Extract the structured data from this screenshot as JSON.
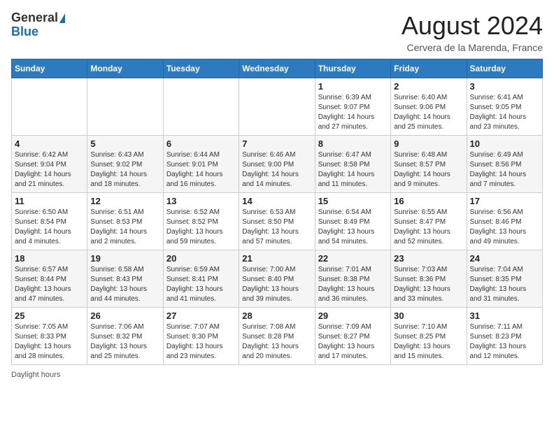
{
  "header": {
    "logo_general": "General",
    "logo_blue": "Blue",
    "month_title": "August 2024",
    "location": "Cervera de la Marenda, France"
  },
  "weekdays": [
    "Sunday",
    "Monday",
    "Tuesday",
    "Wednesday",
    "Thursday",
    "Friday",
    "Saturday"
  ],
  "footer": {
    "daylight_label": "Daylight hours"
  },
  "weeks": [
    {
      "days": [
        null,
        null,
        null,
        null,
        {
          "date": "1",
          "sunrise": "6:39 AM",
          "sunset": "9:07 PM",
          "daylight": "14 hours and 27 minutes."
        },
        {
          "date": "2",
          "sunrise": "6:40 AM",
          "sunset": "9:06 PM",
          "daylight": "14 hours and 25 minutes."
        },
        {
          "date": "3",
          "sunrise": "6:41 AM",
          "sunset": "9:05 PM",
          "daylight": "14 hours and 23 minutes."
        }
      ]
    },
    {
      "days": [
        {
          "date": "4",
          "sunrise": "6:42 AM",
          "sunset": "9:04 PM",
          "daylight": "14 hours and 21 minutes."
        },
        {
          "date": "5",
          "sunrise": "6:43 AM",
          "sunset": "9:02 PM",
          "daylight": "14 hours and 18 minutes."
        },
        {
          "date": "6",
          "sunrise": "6:44 AM",
          "sunset": "9:01 PM",
          "daylight": "14 hours and 16 minutes."
        },
        {
          "date": "7",
          "sunrise": "6:46 AM",
          "sunset": "9:00 PM",
          "daylight": "14 hours and 14 minutes."
        },
        {
          "date": "8",
          "sunrise": "6:47 AM",
          "sunset": "8:58 PM",
          "daylight": "14 hours and 11 minutes."
        },
        {
          "date": "9",
          "sunrise": "6:48 AM",
          "sunset": "8:57 PM",
          "daylight": "14 hours and 9 minutes."
        },
        {
          "date": "10",
          "sunrise": "6:49 AM",
          "sunset": "8:56 PM",
          "daylight": "14 hours and 7 minutes."
        }
      ]
    },
    {
      "days": [
        {
          "date": "11",
          "sunrise": "6:50 AM",
          "sunset": "8:54 PM",
          "daylight": "14 hours and 4 minutes."
        },
        {
          "date": "12",
          "sunrise": "6:51 AM",
          "sunset": "8:53 PM",
          "daylight": "14 hours and 2 minutes."
        },
        {
          "date": "13",
          "sunrise": "6:52 AM",
          "sunset": "8:52 PM",
          "daylight": "13 hours and 59 minutes."
        },
        {
          "date": "14",
          "sunrise": "6:53 AM",
          "sunset": "8:50 PM",
          "daylight": "13 hours and 57 minutes."
        },
        {
          "date": "15",
          "sunrise": "6:54 AM",
          "sunset": "8:49 PM",
          "daylight": "13 hours and 54 minutes."
        },
        {
          "date": "16",
          "sunrise": "6:55 AM",
          "sunset": "8:47 PM",
          "daylight": "13 hours and 52 minutes."
        },
        {
          "date": "17",
          "sunrise": "6:56 AM",
          "sunset": "8:46 PM",
          "daylight": "13 hours and 49 minutes."
        }
      ]
    },
    {
      "days": [
        {
          "date": "18",
          "sunrise": "6:57 AM",
          "sunset": "8:44 PM",
          "daylight": "13 hours and 47 minutes."
        },
        {
          "date": "19",
          "sunrise": "6:58 AM",
          "sunset": "8:43 PM",
          "daylight": "13 hours and 44 minutes."
        },
        {
          "date": "20",
          "sunrise": "6:59 AM",
          "sunset": "8:41 PM",
          "daylight": "13 hours and 41 minutes."
        },
        {
          "date": "21",
          "sunrise": "7:00 AM",
          "sunset": "8:40 PM",
          "daylight": "13 hours and 39 minutes."
        },
        {
          "date": "22",
          "sunrise": "7:01 AM",
          "sunset": "8:38 PM",
          "daylight": "13 hours and 36 minutes."
        },
        {
          "date": "23",
          "sunrise": "7:03 AM",
          "sunset": "8:36 PM",
          "daylight": "13 hours and 33 minutes."
        },
        {
          "date": "24",
          "sunrise": "7:04 AM",
          "sunset": "8:35 PM",
          "daylight": "13 hours and 31 minutes."
        }
      ]
    },
    {
      "days": [
        {
          "date": "25",
          "sunrise": "7:05 AM",
          "sunset": "8:33 PM",
          "daylight": "13 hours and 28 minutes."
        },
        {
          "date": "26",
          "sunrise": "7:06 AM",
          "sunset": "8:32 PM",
          "daylight": "13 hours and 25 minutes."
        },
        {
          "date": "27",
          "sunrise": "7:07 AM",
          "sunset": "8:30 PM",
          "daylight": "13 hours and 23 minutes."
        },
        {
          "date": "28",
          "sunrise": "7:08 AM",
          "sunset": "8:28 PM",
          "daylight": "13 hours and 20 minutes."
        },
        {
          "date": "29",
          "sunrise": "7:09 AM",
          "sunset": "8:27 PM",
          "daylight": "13 hours and 17 minutes."
        },
        {
          "date": "30",
          "sunrise": "7:10 AM",
          "sunset": "8:25 PM",
          "daylight": "13 hours and 15 minutes."
        },
        {
          "date": "31",
          "sunrise": "7:11 AM",
          "sunset": "8:23 PM",
          "daylight": "13 hours and 12 minutes."
        }
      ]
    }
  ]
}
